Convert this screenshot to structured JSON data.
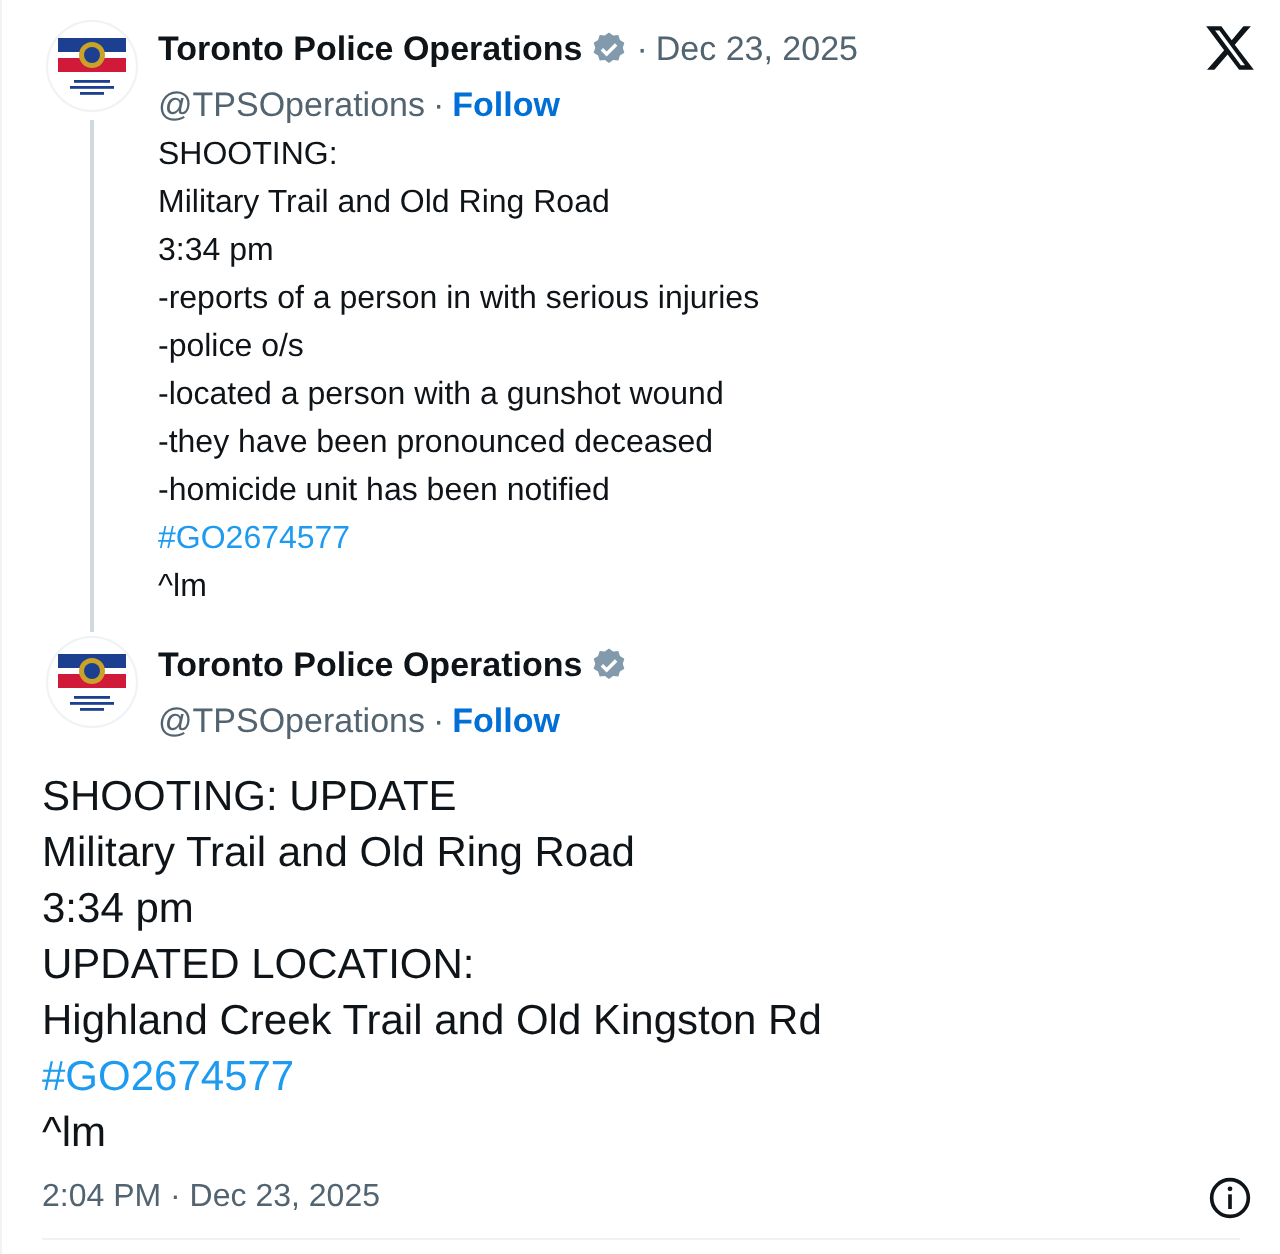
{
  "parent_post": {
    "author": "Toronto Police Operations",
    "verified": true,
    "separator": "·",
    "date": "Dec 23, 2025",
    "handle": "@TPSOperations",
    "follow": "Follow",
    "lines": [
      {
        "text": "SHOOTING:",
        "kind": "plain"
      },
      {
        "text": "Military Trail and Old Ring Road",
        "kind": "plain"
      },
      {
        "text": "3:34 pm",
        "kind": "plain"
      },
      {
        "text": "-reports of a person in with serious injuries",
        "kind": "plain"
      },
      {
        "text": "-police o/s",
        "kind": "plain"
      },
      {
        "text": "-located a person with a gunshot wound",
        "kind": "plain"
      },
      {
        "text": "-they have been pronounced deceased",
        "kind": "plain"
      },
      {
        "text": "-homicide unit has been notified",
        "kind": "plain"
      },
      {
        "text": "#GO2674577",
        "kind": "hashtag"
      },
      {
        "text": "^lm",
        "kind": "plain"
      }
    ]
  },
  "post": {
    "author": "Toronto Police Operations",
    "verified": true,
    "handle": "@TPSOperations",
    "follow": "Follow",
    "lines": [
      {
        "text": "SHOOTING: UPDATE",
        "kind": "plain"
      },
      {
        "text": "Military Trail and Old Ring Road",
        "kind": "plain"
      },
      {
        "text": "3:34 pm",
        "kind": "plain"
      },
      {
        "text": "UPDATED LOCATION:",
        "kind": "plain"
      },
      {
        "text": "Highland Creek Trail and Old Kingston Rd",
        "kind": "plain"
      },
      {
        "text": "#GO2674577",
        "kind": "hashtag"
      },
      {
        "text": "^lm",
        "kind": "plain"
      }
    ],
    "timestamp": "2:04 PM · Dec 23, 2025"
  }
}
